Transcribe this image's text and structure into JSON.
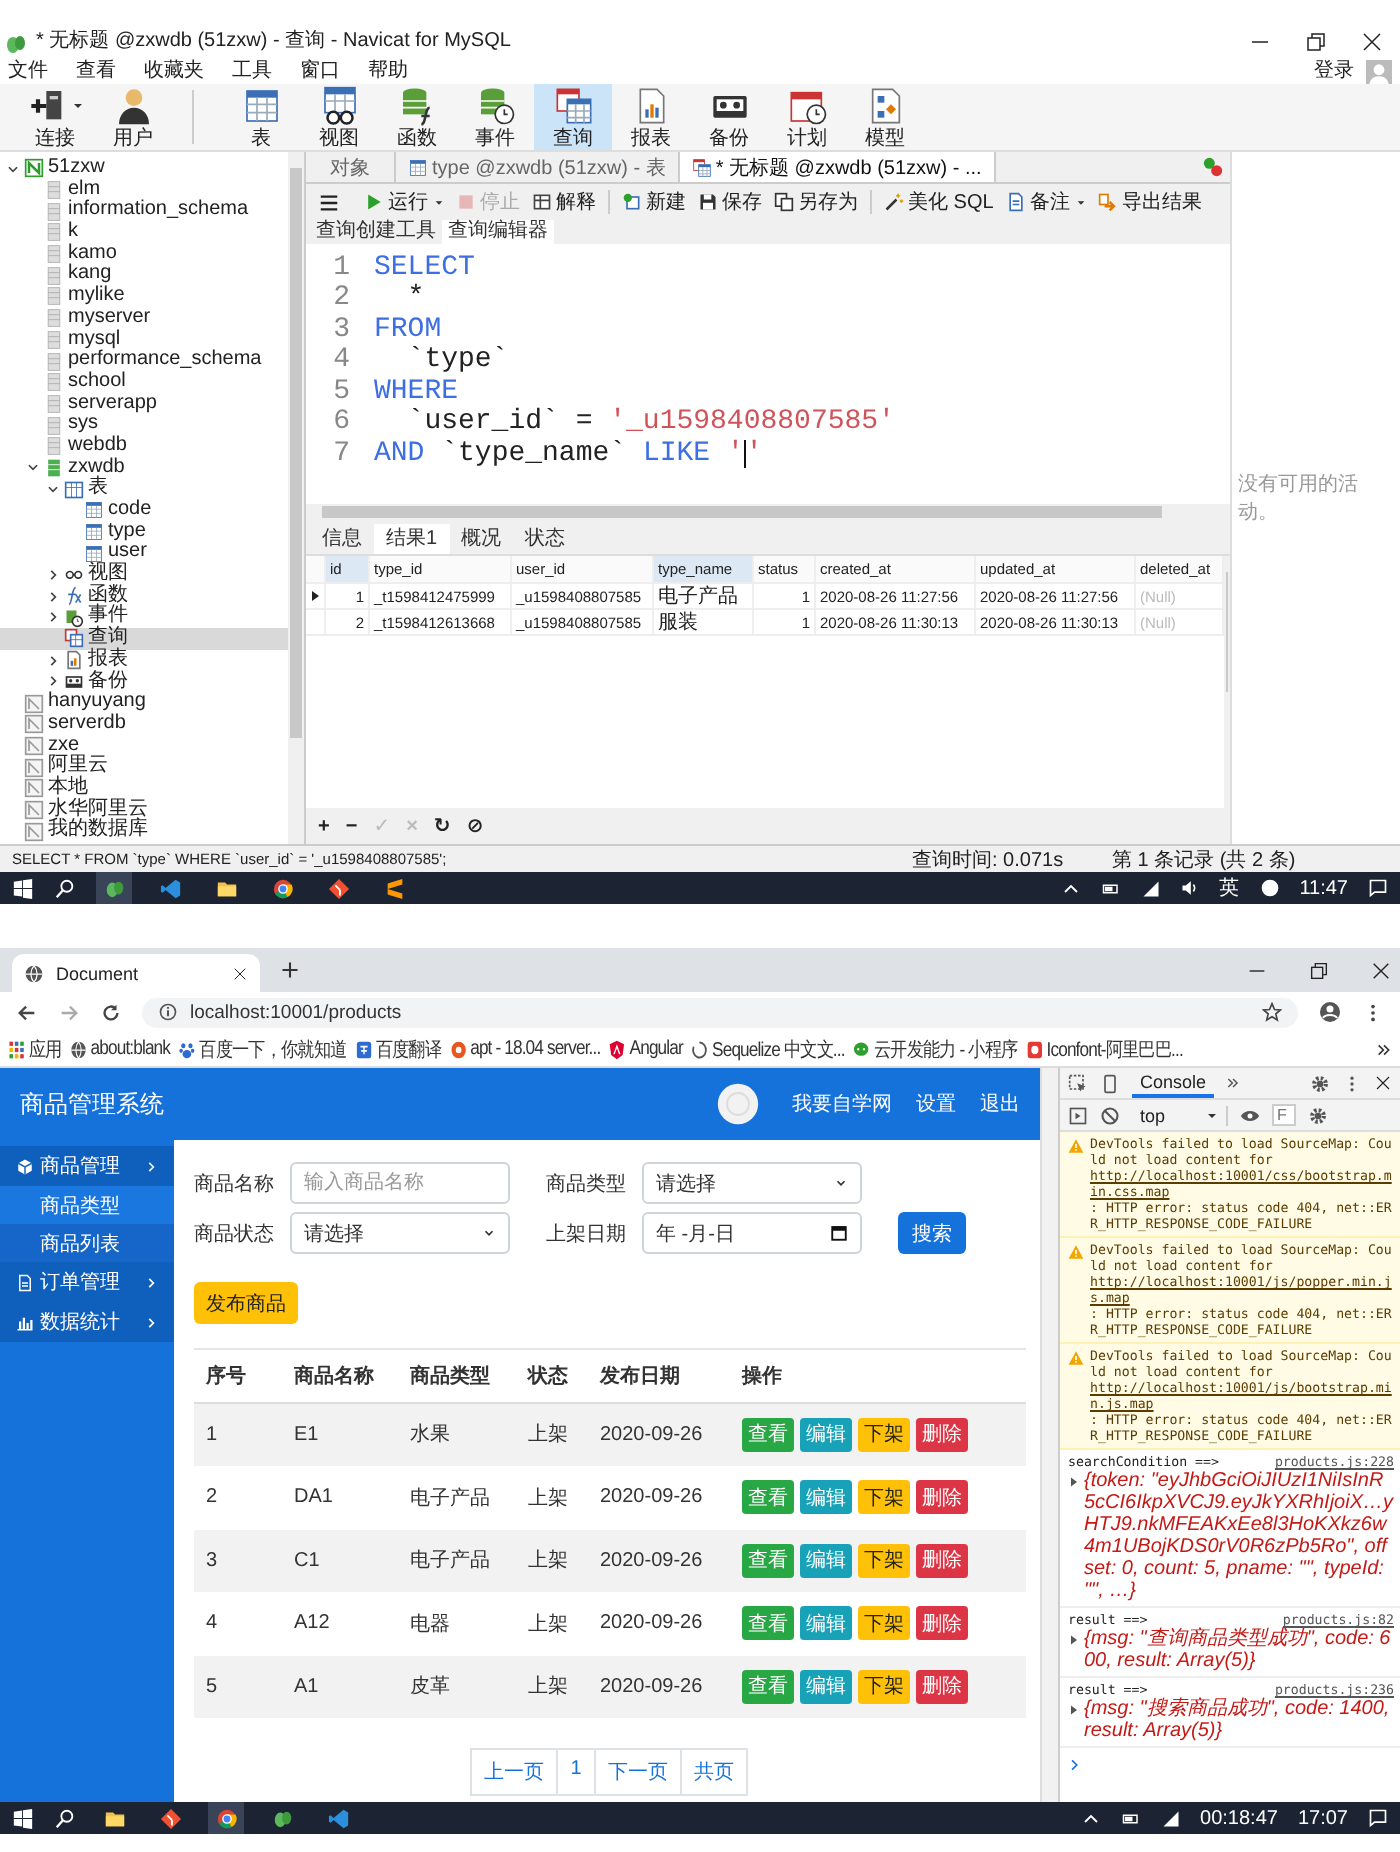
{
  "navicat": {
    "window_title": "* 无标题 @zxwdb (51zxw) - 查询 - Navicat for MySQL",
    "menu": [
      "文件",
      "查看",
      "收藏夹",
      "工具",
      "窗口",
      "帮助"
    ],
    "login": "登录",
    "connection_tools": [
      {
        "label": "连接",
        "kind": "plug",
        "dropdown": true,
        "selected": false
      },
      {
        "label": "用户",
        "kind": "user",
        "dropdown": false,
        "selected": false
      }
    ],
    "object_tools": [
      {
        "label": "表",
        "kind": "table",
        "selected": false
      },
      {
        "label": "视图",
        "kind": "view",
        "selected": false
      },
      {
        "label": "函数",
        "kind": "func",
        "selected": false
      },
      {
        "label": "事件",
        "kind": "event",
        "selected": false
      },
      {
        "label": "查询",
        "kind": "query",
        "selected": true
      },
      {
        "label": "报表",
        "kind": "report",
        "selected": false
      },
      {
        "label": "备份",
        "kind": "backup",
        "selected": false
      },
      {
        "label": "计划",
        "kind": "schedule",
        "selected": false
      },
      {
        "label": "模型",
        "kind": "model",
        "selected": false
      }
    ],
    "tree": [
      {
        "label": "51zxw",
        "kind": "conn_on",
        "expanded": true,
        "selected": false,
        "children": [
          {
            "label": "elm",
            "kind": "db",
            "selected": false
          },
          {
            "label": "information_schema",
            "kind": "db",
            "selected": false
          },
          {
            "label": "k",
            "kind": "db",
            "selected": false
          },
          {
            "label": "kamo",
            "kind": "db",
            "selected": false
          },
          {
            "label": "kang",
            "kind": "db",
            "selected": false
          },
          {
            "label": "mylike",
            "kind": "db",
            "selected": false
          },
          {
            "label": "myserver",
            "kind": "db",
            "selected": false
          },
          {
            "label": "mysql",
            "kind": "db",
            "selected": false
          },
          {
            "label": "performance_schema",
            "kind": "db",
            "selected": false
          },
          {
            "label": "school",
            "kind": "db",
            "selected": false
          },
          {
            "label": "serverapp",
            "kind": "db",
            "selected": false
          },
          {
            "label": "sys",
            "kind": "db",
            "selected": false
          },
          {
            "label": "webdb",
            "kind": "db",
            "selected": false
          },
          {
            "label": "zxwdb",
            "kind": "db_on",
            "expanded": true,
            "selected": false,
            "children": [
              {
                "label": "表",
                "kind": "tables",
                "expanded": true,
                "selected": false,
                "children": [
                  {
                    "label": "code",
                    "kind": "table",
                    "selected": false
                  },
                  {
                    "label": "type",
                    "kind": "table",
                    "selected": false
                  },
                  {
                    "label": "user",
                    "kind": "table",
                    "selected": false
                  }
                ]
              },
              {
                "label": "视图",
                "kind": "views",
                "expanded": false,
                "selected": false
              },
              {
                "label": "函数",
                "kind": "functions",
                "expanded": false,
                "selected": false
              },
              {
                "label": "事件",
                "kind": "events",
                "expanded": false,
                "selected": false
              },
              {
                "label": "查询",
                "kind": "queries",
                "selected": true
              },
              {
                "label": "报表",
                "kind": "reports",
                "expanded": false,
                "selected": false
              },
              {
                "label": "备份",
                "kind": "backups",
                "expanded": false,
                "selected": false
              }
            ]
          }
        ]
      },
      {
        "label": "hanyuyang",
        "kind": "conn_off",
        "selected": false
      },
      {
        "label": "serverdb",
        "kind": "conn_off",
        "selected": false
      },
      {
        "label": "zxe",
        "kind": "conn_off",
        "selected": false
      },
      {
        "label": "阿里云",
        "kind": "conn_off",
        "selected": false
      },
      {
        "label": "本地",
        "kind": "conn_off",
        "selected": false
      },
      {
        "label": "水华阿里云",
        "kind": "conn_off",
        "selected": false
      },
      {
        "label": "我的数据库",
        "kind": "conn_off",
        "selected": false
      }
    ],
    "tabs": [
      {
        "label": "对象",
        "kind": "objects",
        "selected": false
      },
      {
        "label": "type @zxwdb (51zxw) - 表",
        "kind": "table",
        "selected": false
      },
      {
        "label": "* 无标题 @zxwdb (51zxw) - ...",
        "kind": "query",
        "selected": true
      }
    ],
    "query_toolbar": [
      {
        "label": "运行",
        "kind": "run",
        "disabled": false,
        "dropdown": true
      },
      {
        "label": "停止",
        "kind": "stop",
        "disabled": true,
        "dropdown": false
      },
      {
        "label": "解释",
        "kind": "explain",
        "disabled": false,
        "dropdown": false
      },
      {
        "label": "新建",
        "kind": "new",
        "disabled": false,
        "dropdown": false
      },
      {
        "label": "保存",
        "kind": "save",
        "disabled": false,
        "dropdown": false
      },
      {
        "label": "另存为",
        "kind": "save_as",
        "disabled": false,
        "dropdown": false
      },
      {
        "label": "美化 SQL",
        "kind": "beautify",
        "disabled": false,
        "dropdown": false
      },
      {
        "label": "备注",
        "kind": "comment",
        "disabled": false,
        "dropdown": true
      },
      {
        "label": "导出结果",
        "kind": "export",
        "disabled": false,
        "dropdown": false
      }
    ],
    "editor_tabs": [
      {
        "label": "查询创建工具",
        "selected": false
      },
      {
        "label": "查询编辑器",
        "selected": true
      }
    ],
    "sql_lines": [
      {
        "number": "1",
        "tokens": [
          {
            "text": "SELECT",
            "kind": "keyword"
          }
        ]
      },
      {
        "number": "2",
        "tokens": [
          {
            "text": "  *",
            "kind": "plain"
          }
        ]
      },
      {
        "number": "3",
        "tokens": [
          {
            "text": "FROM",
            "kind": "keyword"
          }
        ]
      },
      {
        "number": "4",
        "tokens": [
          {
            "text": "  `type`",
            "kind": "plain"
          }
        ]
      },
      {
        "number": "5",
        "tokens": [
          {
            "text": "WHERE",
            "kind": "keyword"
          }
        ]
      },
      {
        "number": "6",
        "tokens": [
          {
            "text": "  `user_id` = ",
            "kind": "plain"
          },
          {
            "text": "'_u1598408807585'",
            "kind": "string"
          }
        ]
      },
      {
        "number": "7",
        "tokens": [
          {
            "text": "AND",
            "kind": "keyword"
          },
          {
            "text": " `type_name` ",
            "kind": "plain"
          },
          {
            "text": "LIKE",
            "kind": "keyword"
          },
          {
            "text": " '",
            "kind": "string"
          },
          {
            "kind": "cursor"
          },
          {
            "text": "'",
            "kind": "string"
          }
        ]
      }
    ],
    "activity_note": "没有可用的活动。",
    "result_tabs": [
      {
        "label": "信息",
        "selected": false
      },
      {
        "label": "结果1",
        "selected": true
      },
      {
        "label": "概况",
        "selected": false
      },
      {
        "label": "状态",
        "selected": false
      }
    ],
    "result_columns": [
      "id",
      "type_id",
      "user_id",
      "type_name",
      "status",
      "created_at",
      "updated_at",
      "deleted_at"
    ],
    "result_rows": [
      {
        "current": true,
        "cells": [
          "1",
          "_t1598412475999",
          "_u1598408807585",
          "电子产品",
          "1",
          "2020-08-26 11:27:56",
          "2020-08-26 11:27:56",
          "(Null)"
        ]
      },
      {
        "current": false,
        "cells": [
          "2",
          "_t1598412613668",
          "_u1598408807585",
          "服装",
          "1",
          "2020-08-26 11:30:13",
          "2020-08-26 11:30:13",
          "(Null)"
        ]
      }
    ],
    "record_buttons": [
      {
        "glyph": "+",
        "disabled": false
      },
      {
        "glyph": "−",
        "disabled": false
      },
      {
        "glyph": "✓",
        "disabled": true
      },
      {
        "glyph": "×",
        "disabled": true
      },
      {
        "glyph": "↻",
        "disabled": false
      },
      {
        "glyph": "⊘",
        "disabled": false
      }
    ],
    "status_sql": "SELECT * FROM `type` WHERE `user_id` = '_u1598408807585';",
    "status_time": "查询时间: 0.071s",
    "status_records": "第 1 条记录 (共 2 条)",
    "taskbar_apps": [
      {
        "kind": "navicat",
        "active": true
      },
      {
        "kind": "vscode",
        "active": false
      },
      {
        "kind": "folder",
        "active": false
      },
      {
        "kind": "chrome",
        "active": false
      },
      {
        "kind": "git",
        "active": false
      },
      {
        "kind": "sublime",
        "active": false
      }
    ],
    "tray_ime": "英",
    "tray_time": "11:47"
  },
  "browser": {
    "tab_title": "Document",
    "url": "localhost:10001/products",
    "bookmarks": [
      {
        "label": "应用",
        "kind": "apps"
      },
      {
        "label": "about:blank",
        "kind": "globe"
      },
      {
        "label": "百度一下，你就知道",
        "kind": "paw"
      },
      {
        "label": "百度翻译",
        "kind": "translate"
      },
      {
        "label": "apt - 18.04 server...",
        "kind": "circle_logo"
      },
      {
        "label": "Angular",
        "kind": "shield"
      },
      {
        "label": "Sequelize 中文文...",
        "kind": "ring"
      },
      {
        "label": "云开发能力 - 小程序",
        "kind": "chat"
      },
      {
        "label": "Iconfont-阿里巴巴...",
        "kind": "square_logo"
      }
    ],
    "app": {
      "brand": "商品管理系统",
      "header_links": [
        "我要自学网",
        "设置",
        "退出"
      ],
      "menu": [
        {
          "label": "商品管理",
          "kind": "cube",
          "expanded": true,
          "children": [
            {
              "label": "商品类型",
              "selected": false
            },
            {
              "label": "商品列表",
              "selected": true
            }
          ]
        },
        {
          "label": "订单管理",
          "kind": "doc",
          "expanded": false
        },
        {
          "label": "数据统计",
          "kind": "chart",
          "expanded": false
        }
      ],
      "filters": [
        {
          "label": "商品名称",
          "kind": "text",
          "placeholder": "输入商品名称"
        },
        {
          "label": "商品类型",
          "kind": "select",
          "value": "请选择"
        },
        {
          "label": "商品状态",
          "kind": "select",
          "value": "请选择"
        },
        {
          "label": "上架日期",
          "kind": "date",
          "value": "年 -月-日"
        }
      ],
      "search_button": "搜索",
      "publish_button": "发布商品",
      "columns": [
        "序号",
        "商品名称",
        "商品类型",
        "状态",
        "发布日期",
        "操作"
      ],
      "rows": [
        {
          "cells": [
            "1",
            "E1",
            "水果",
            "上架",
            "2020-09-26"
          ],
          "actions": [
            {
              "label": "查看",
              "kind": "view"
            },
            {
              "label": "编辑",
              "kind": "edit"
            },
            {
              "label": "下架",
              "kind": "offline"
            },
            {
              "label": "删除",
              "kind": "delete"
            }
          ]
        },
        {
          "cells": [
            "2",
            "DA1",
            "电子产品",
            "上架",
            "2020-09-26"
          ],
          "actions": [
            {
              "label": "查看",
              "kind": "view"
            },
            {
              "label": "编辑",
              "kind": "edit"
            },
            {
              "label": "下架",
              "kind": "offline"
            },
            {
              "label": "删除",
              "kind": "delete"
            }
          ]
        },
        {
          "cells": [
            "3",
            "C1",
            "电子产品",
            "上架",
            "2020-09-26"
          ],
          "actions": [
            {
              "label": "查看",
              "kind": "view"
            },
            {
              "label": "编辑",
              "kind": "edit"
            },
            {
              "label": "下架",
              "kind": "offline"
            },
            {
              "label": "删除",
              "kind": "delete"
            }
          ]
        },
        {
          "cells": [
            "4",
            "A12",
            "电器",
            "上架",
            "2020-09-26"
          ],
          "actions": [
            {
              "label": "查看",
              "kind": "view"
            },
            {
              "label": "编辑",
              "kind": "edit"
            },
            {
              "label": "下架",
              "kind": "offline"
            },
            {
              "label": "删除",
              "kind": "delete"
            }
          ]
        },
        {
          "cells": [
            "5",
            "A1",
            "皮革",
            "上架",
            "2020-09-26"
          ],
          "actions": [
            {
              "label": "查看",
              "kind": "view"
            },
            {
              "label": "编辑",
              "kind": "edit"
            },
            {
              "label": "下架",
              "kind": "offline"
            },
            {
              "label": "删除",
              "kind": "delete"
            }
          ]
        }
      ],
      "pagination": [
        "上一页",
        "1",
        "下一页",
        "共页"
      ]
    },
    "devtools": {
      "tab": "Console",
      "context": "top",
      "filter_placeholder": "F",
      "messages": [
        {
          "kind": "warning",
          "text": "DevTools failed to load SourceMap: Could not load content for ",
          "link": "http://localhost:10001/css/bootstrap.min.css.map",
          "after": ": HTTP error: status code 404, net::ERR_HTTP_RESPONSE_CODE_FAILURE"
        },
        {
          "kind": "warning",
          "text": "DevTools failed to load SourceMap: Could not load content for ",
          "link": "http://localhost:10001/js/popper.min.js.map",
          "after": ": HTTP error: status code 404, net::ERR_HTTP_RESPONSE_CODE_FAILURE"
        },
        {
          "kind": "warning",
          "text": "DevTools failed to load SourceMap: Could not load content for ",
          "link": "http://localhost:10001/js/bootstrap.min.js.map",
          "after": ": HTTP error: status code 404, net::ERR_HTTP_RESPONSE_CODE_FAILURE"
        },
        {
          "kind": "log",
          "text": "searchCondition ==>",
          "link": "products.js:228",
          "value": "{token: \"eyJhbGciOiJIUzI1NiIsInR5cCI6IkpXVCJ9.eyJkYXRhIjoiX…yHTJ9.nkMFEAKxEe8l3HoKXkz6w4m1UBojKDS0rV0R6zPb5Ro\", offset: 0, count: 5, pname: \"\", typeId: \"\", …}"
        },
        {
          "kind": "log",
          "text": "result ==>",
          "link": "products.js:82",
          "value": "{msg: \"查询商品类型成功\", code: 600, result: Array(5)}"
        },
        {
          "kind": "log",
          "text": "result ==>",
          "link": "products.js:236",
          "value": "{msg: \"搜索商品成功\", code: 1400, result: Array(5)}"
        }
      ]
    },
    "taskbar_apps": [
      {
        "kind": "folder",
        "active": false
      },
      {
        "kind": "git",
        "active": false
      },
      {
        "kind": "chrome",
        "active": true
      },
      {
        "kind": "navicat",
        "active": false
      },
      {
        "kind": "vscode",
        "active": false
      }
    ],
    "tray_timer": "00:18:47",
    "tray_time": "17:07"
  }
}
